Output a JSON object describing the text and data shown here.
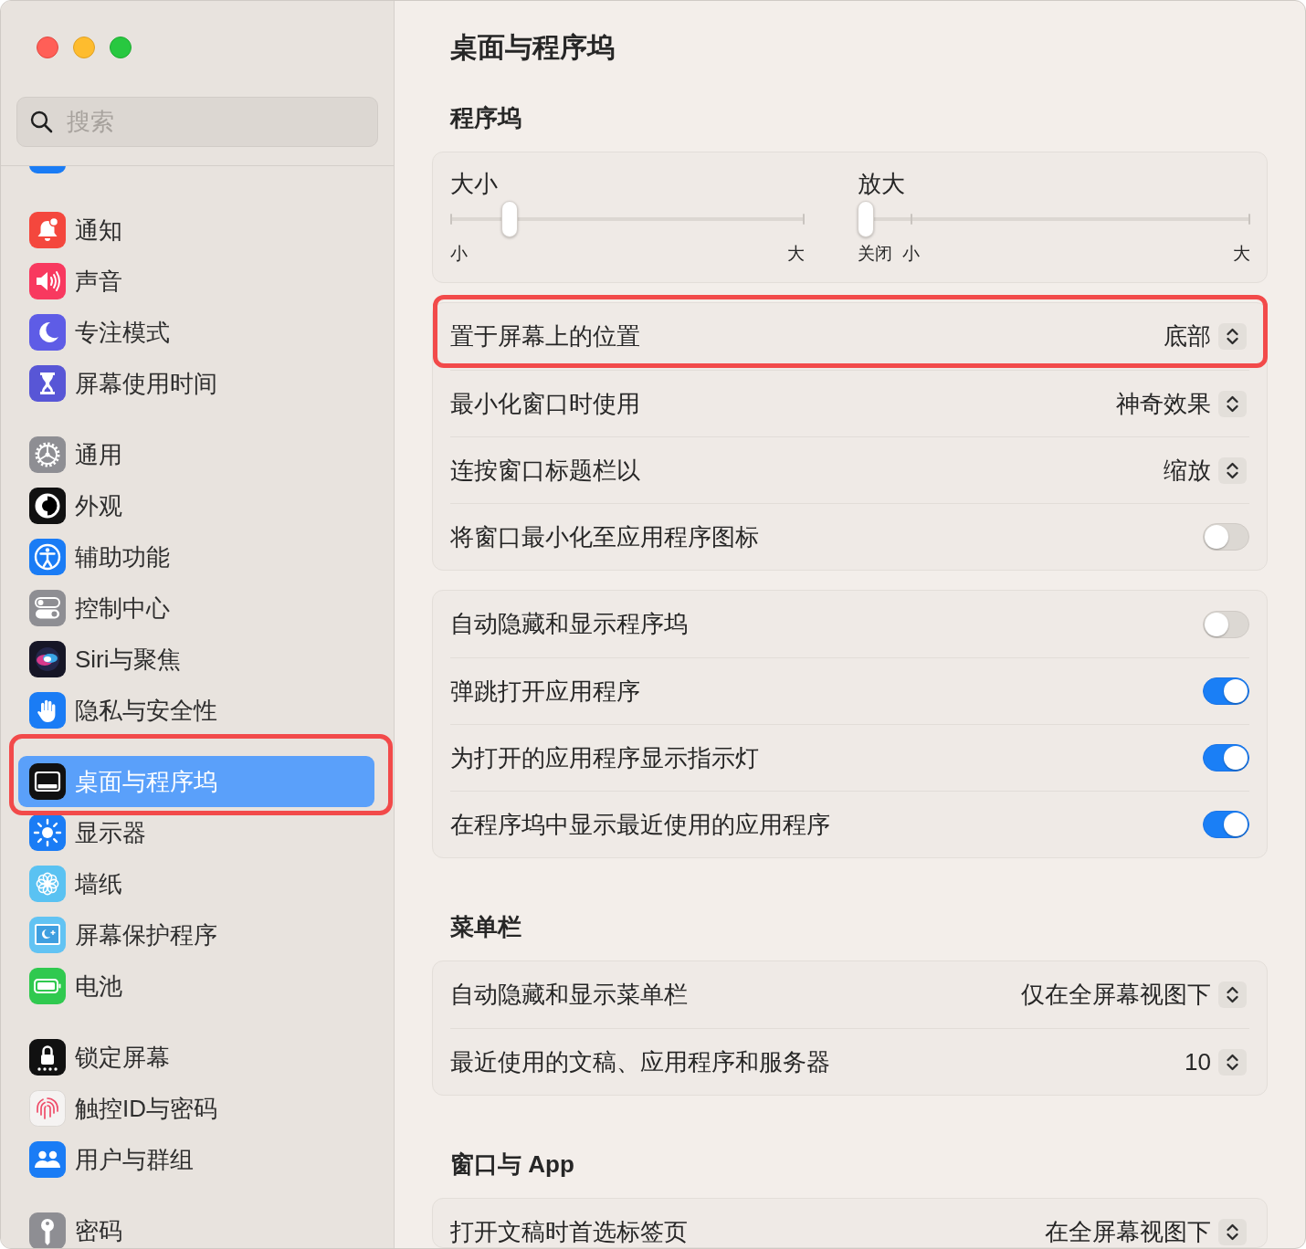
{
  "sidebar": {
    "search": {
      "placeholder": "搜索"
    },
    "groups": [
      {
        "items": [
          {
            "label": "通知",
            "selected": false,
            "outlined": false
          },
          {
            "label": "声音",
            "selected": false,
            "outlined": false
          },
          {
            "label": "专注模式",
            "selected": false,
            "outlined": false
          },
          {
            "label": "屏幕使用时间",
            "selected": false,
            "outlined": false
          }
        ]
      },
      {
        "items": [
          {
            "label": "通用",
            "selected": false,
            "outlined": false
          },
          {
            "label": "外观",
            "selected": false,
            "outlined": false
          },
          {
            "label": "辅助功能",
            "selected": false,
            "outlined": false
          },
          {
            "label": "控制中心",
            "selected": false,
            "outlined": false
          },
          {
            "label": "Siri与聚焦",
            "selected": false,
            "outlined": false
          },
          {
            "label": "隐私与安全性",
            "selected": false,
            "outlined": false
          }
        ]
      },
      {
        "items": [
          {
            "label": "桌面与程序坞",
            "selected": true,
            "outlined": true
          },
          {
            "label": "显示器",
            "selected": false,
            "outlined": false
          },
          {
            "label": "墙纸",
            "selected": false,
            "outlined": false
          },
          {
            "label": "屏幕保护程序",
            "selected": false,
            "outlined": false
          },
          {
            "label": "电池",
            "selected": false,
            "outlined": false
          }
        ]
      },
      {
        "items": [
          {
            "label": "锁定屏幕",
            "selected": false,
            "outlined": false
          },
          {
            "label": "触控ID与密码",
            "selected": false,
            "outlined": false
          },
          {
            "label": "用户与群组",
            "selected": false,
            "outlined": false
          }
        ]
      },
      {
        "items": [
          {
            "label": "密码",
            "selected": false,
            "outlined": false
          }
        ]
      }
    ]
  },
  "content": {
    "title": "桌面与程序坞",
    "sections": [
      {
        "heading": "程序坞",
        "cards": [
          {
            "kind": "sliders",
            "sliders": [
              {
                "label": "大小",
                "kind": "plain",
                "level": 0.15,
                "scale_labels": [
                  "小",
                  "大"
                ]
              },
              {
                "label": "放大",
                "kind": "off_step",
                "level": 0,
                "scale_labels": [
                  "关闭",
                  "小",
                  "大"
                ]
              }
            ]
          },
          {
            "kind": "rows",
            "rows": [
              {
                "kind": "popup",
                "label": "置于屏幕上的位置",
                "value": "底部",
                "outlined": true
              },
              {
                "kind": "popup",
                "label": "最小化窗口时使用",
                "value": "神奇效果",
                "outlined": false
              },
              {
                "kind": "popup",
                "label": "连按窗口标题栏以",
                "value": "缩放",
                "outlined": false
              },
              {
                "kind": "toggle",
                "label": "将窗口最小化至应用程序图标",
                "on": false,
                "outlined": false
              }
            ]
          },
          {
            "kind": "rows",
            "rows": [
              {
                "kind": "toggle",
                "label": "自动隐藏和显示程序坞",
                "on": false
              },
              {
                "kind": "toggle",
                "label": "弹跳打开应用程序",
                "on": true
              },
              {
                "kind": "toggle",
                "label": "为打开的应用程序显示指示灯",
                "on": true
              },
              {
                "kind": "toggle",
                "label": "在程序坞中显示最近使用的应用程序",
                "on": true
              }
            ]
          }
        ]
      },
      {
        "heading": "菜单栏",
        "cards": [
          {
            "kind": "rows",
            "rows": [
              {
                "kind": "popup",
                "label": "自动隐藏和显示菜单栏",
                "value": "仅在全屏幕视图下"
              },
              {
                "kind": "popup",
                "label": "最近使用的文稿、应用程序和服务器",
                "value": "10"
              }
            ]
          }
        ]
      },
      {
        "heading": "窗口与 App",
        "cards": [
          {
            "kind": "rows",
            "rows": [
              {
                "kind": "popup",
                "label": "打开文稿时首选标签页",
                "value": "在全屏幕视图下"
              }
            ]
          }
        ]
      }
    ]
  }
}
